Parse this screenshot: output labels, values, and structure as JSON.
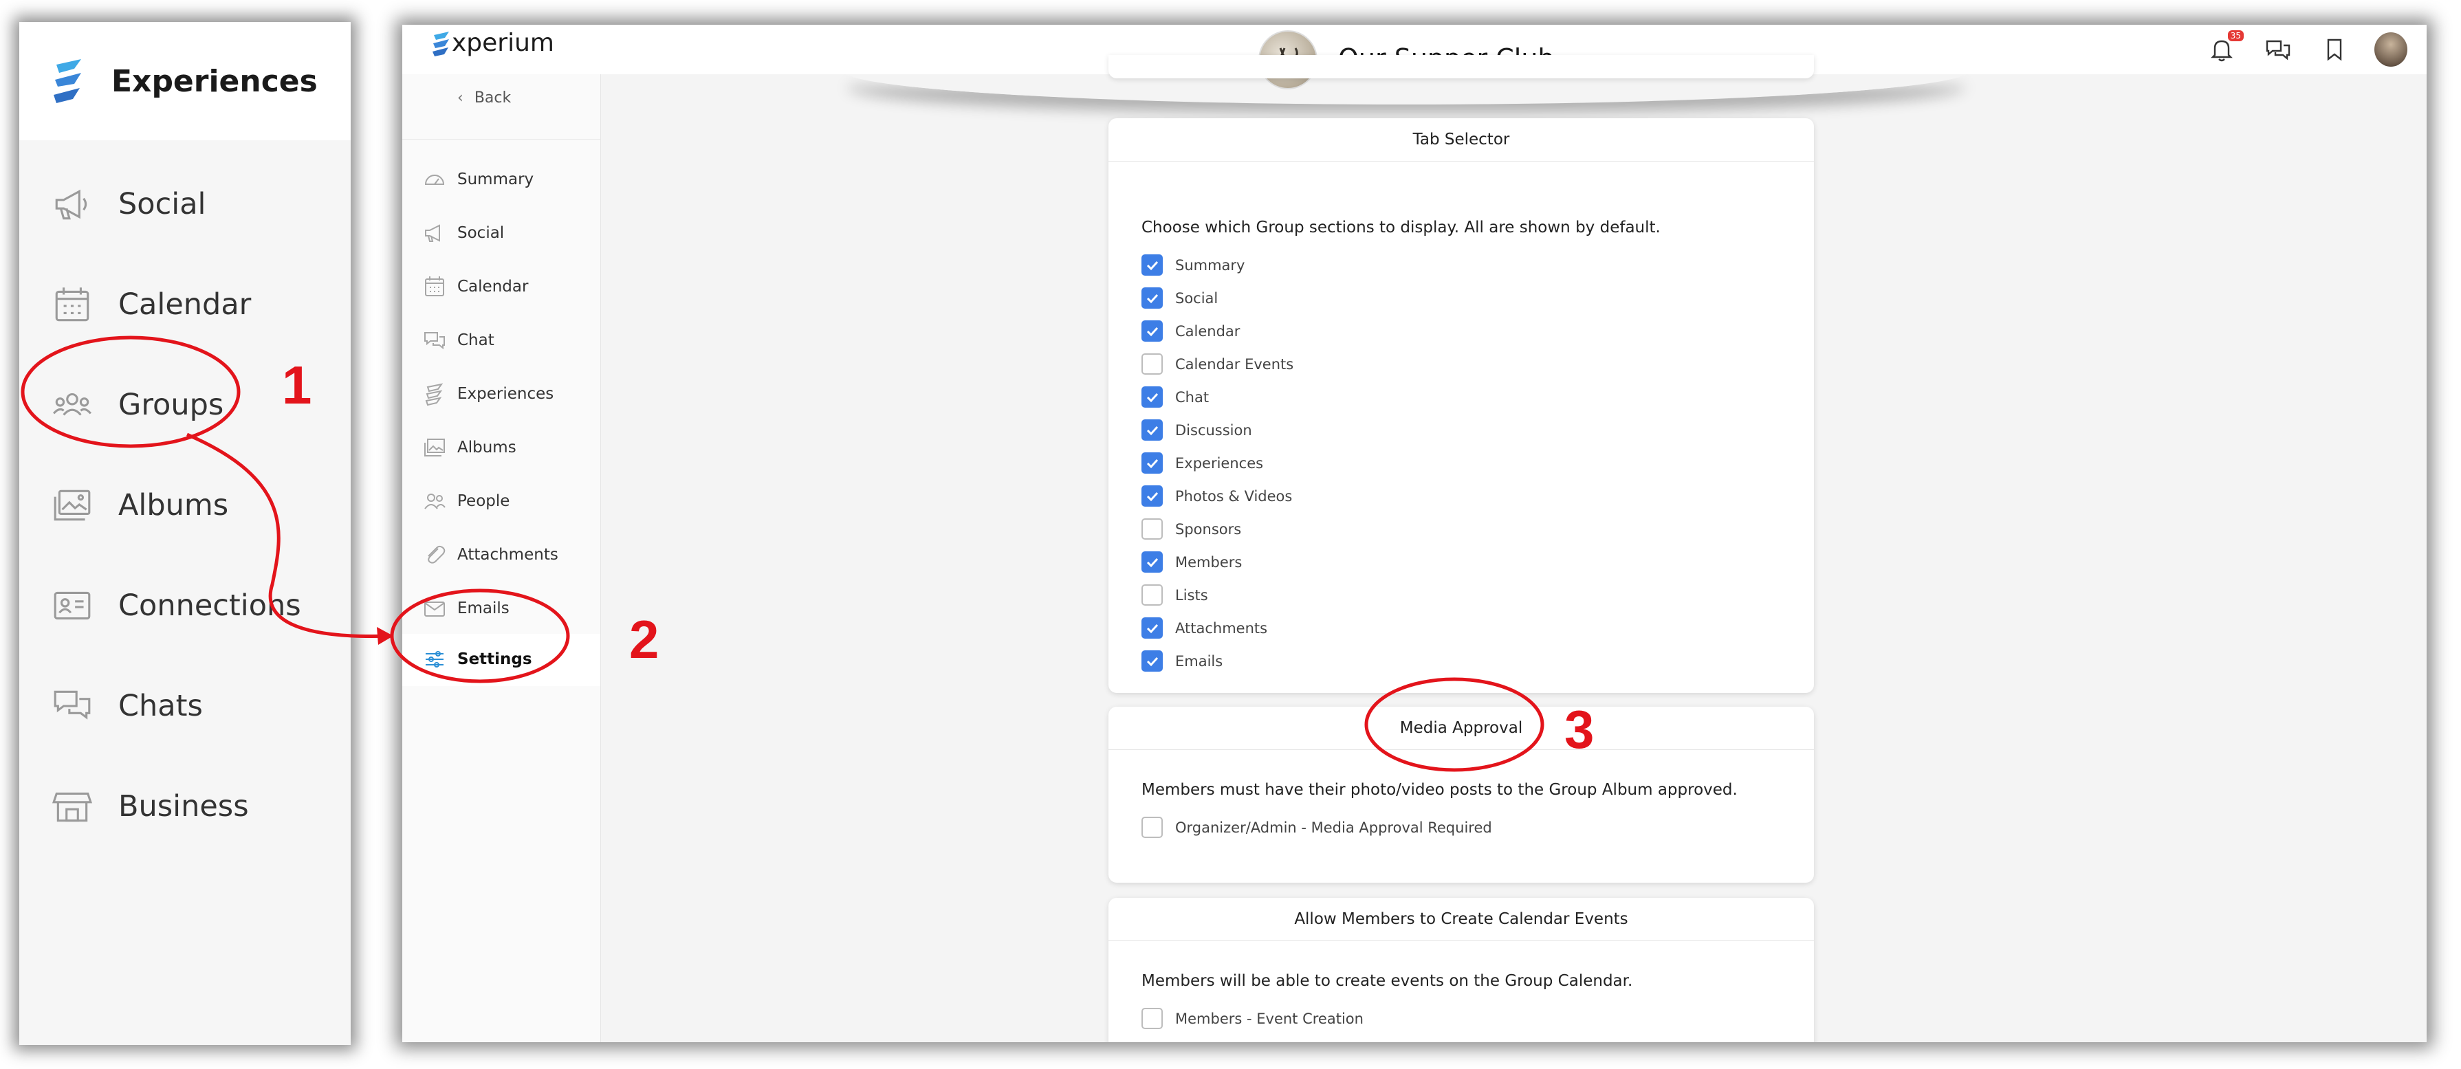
{
  "left_panel": {
    "title": "Experiences",
    "items": [
      {
        "label": "Social",
        "icon": "megaphone-icon"
      },
      {
        "label": "Calendar",
        "icon": "calendar-icon"
      },
      {
        "label": "Groups",
        "icon": "groups-icon"
      },
      {
        "label": "Albums",
        "icon": "albums-icon"
      },
      {
        "label": "Connections",
        "icon": "contact-card-icon"
      },
      {
        "label": "Chats",
        "icon": "chat-bubbles-icon"
      },
      {
        "label": "Business",
        "icon": "store-icon"
      }
    ]
  },
  "header": {
    "logo_text": "xperium",
    "group_name": "Our Supper Club",
    "notification_count": "35"
  },
  "sidebar": {
    "back_label": "Back",
    "items": [
      {
        "label": "Summary",
        "icon": "gauge-icon"
      },
      {
        "label": "Social",
        "icon": "megaphone-icon"
      },
      {
        "label": "Calendar",
        "icon": "calendar-icon"
      },
      {
        "label": "Chat",
        "icon": "chat-bubbles-icon"
      },
      {
        "label": "Experiences",
        "icon": "experiences-icon"
      },
      {
        "label": "Albums",
        "icon": "albums-icon"
      },
      {
        "label": "People",
        "icon": "people-icon"
      },
      {
        "label": "Attachments",
        "icon": "paperclip-icon"
      },
      {
        "label": "Emails",
        "icon": "envelope-icon"
      },
      {
        "label": "Settings",
        "icon": "sliders-icon"
      }
    ],
    "active": "Settings"
  },
  "tab_selector": {
    "title": "Tab Selector",
    "description": "Choose which Group sections to display. All are shown by default.",
    "options": [
      {
        "label": "Summary",
        "checked": true
      },
      {
        "label": "Social",
        "checked": true
      },
      {
        "label": "Calendar",
        "checked": true
      },
      {
        "label": "Calendar Events",
        "checked": false
      },
      {
        "label": "Chat",
        "checked": true
      },
      {
        "label": "Discussion",
        "checked": true
      },
      {
        "label": "Experiences",
        "checked": true
      },
      {
        "label": "Photos & Videos",
        "checked": true
      },
      {
        "label": "Sponsors",
        "checked": false
      },
      {
        "label": "Members",
        "checked": true
      },
      {
        "label": "Lists",
        "checked": false
      },
      {
        "label": "Attachments",
        "checked": true
      },
      {
        "label": "Emails",
        "checked": true
      }
    ]
  },
  "media_approval": {
    "title": "Media Approval",
    "description": "Members must have their photo/video posts to the Group Album approved.",
    "option": {
      "label": "Organizer/Admin - Media Approval Required",
      "checked": false
    }
  },
  "calendar_events": {
    "title": "Allow Members to Create Calendar Events",
    "description": "Members will be able to create events on the Group Calendar.",
    "option": {
      "label": "Members - Event Creation",
      "checked": false
    }
  },
  "annotations": {
    "step1": "1",
    "step2": "2",
    "step3": "3",
    "color": "#e3141b"
  },
  "colors": {
    "checkbox_checked": "#3d7ee6",
    "active_icon": "#2b8fd6"
  }
}
